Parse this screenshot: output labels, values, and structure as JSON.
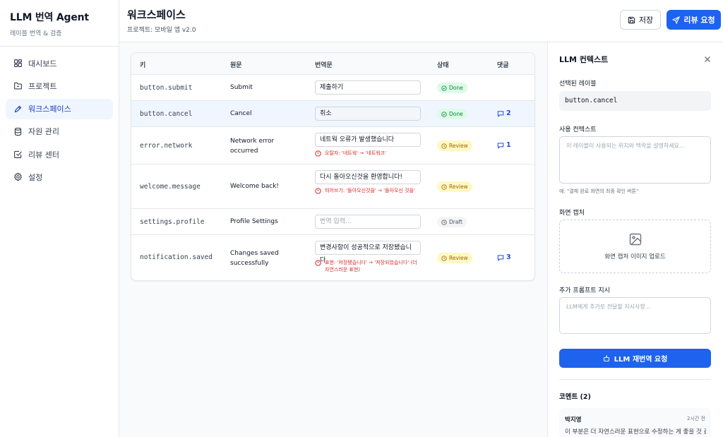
{
  "app": {
    "title": "LLM 번역 Agent",
    "subtitle": "레이블 번역 & 검증"
  },
  "sidebar": {
    "items": [
      {
        "label": "대시보드",
        "icon": "dashboard-icon"
      },
      {
        "label": "프로젝트",
        "icon": "folder-icon"
      },
      {
        "label": "워크스페이스",
        "icon": "pen-icon",
        "active": true
      },
      {
        "label": "자원 관리",
        "icon": "database-icon"
      },
      {
        "label": "리뷰 센터",
        "icon": "check-square-icon"
      },
      {
        "label": "설정",
        "icon": "gear-icon"
      }
    ]
  },
  "header": {
    "title": "워크스페이스",
    "subtitle": "프로젝트: 모바일 앱 v2.0",
    "save_label": "저장",
    "review_label": "리뷰 요청"
  },
  "table": {
    "headers": {
      "key": "키",
      "source": "원문",
      "translation": "번역문",
      "status": "상태",
      "comments": "댓글"
    },
    "rows": [
      {
        "key": "button.submit",
        "source": "Submit",
        "translation": "제출하기",
        "status": "Done",
        "comments": ""
      },
      {
        "key": "button.cancel",
        "source": "Cancel",
        "translation": "취소",
        "status": "Done",
        "comments": "2",
        "selected": true
      },
      {
        "key": "error.network",
        "source": "Network error occurred",
        "translation": "네트웍 오류가 발생했습니다",
        "warning": "오탈자: '네트웍' → '네트워크'",
        "status": "Review",
        "comments": "1"
      },
      {
        "key": "welcome.message",
        "source": "Welcome back!",
        "translation": "다시 돌아오신것을 환영합니다!",
        "warning": "띄어쓰기: '돌아오신것을' → '돌아오신 것을'",
        "status": "Review",
        "comments": ""
      },
      {
        "key": "settings.profile",
        "source": "Profile Settings",
        "translation": "",
        "placeholder": "번역 입력...",
        "status": "Draft",
        "comments": ""
      },
      {
        "key": "notification.saved",
        "source": "Changes saved successfully",
        "translation": "변경사항이 성공적으로 저장됐습니다",
        "warning": "표현: '저장됐습니다' → '저장되었습니다' (더 자연스러운 표현)",
        "status": "Review",
        "comments": "3"
      }
    ]
  },
  "panel": {
    "title": "LLM 컨텍스트",
    "selected_label_title": "선택된 레이블",
    "selected_label_value": "button.cancel",
    "context_title": "사용 컨텍스트",
    "context_placeholder": "이 레이블이 사용되는 위치와 맥락을 설명하세요...",
    "context_hint": "예: \"결제 완료 화면의 최종 확인 버튼\"",
    "capture_title": "화면 캡처",
    "capture_upload": "화면 캡처 이미지 업로드",
    "prompt_title": "추가 프롬프트 지시",
    "prompt_placeholder": "LLM에게 추가로 전달할 지시사항...",
    "retranslate_label": "LLM 재번역 요청",
    "comments_title": "코멘트 (2)",
    "comment": {
      "author": "박지영",
      "time": "2시간 전",
      "text": "이 부분은 더 자연스러운 표현으로 수정하는 게 좋을 것 같아요"
    }
  },
  "colors": {
    "accent": "#1d63ed",
    "done": "#15803d",
    "review": "#a16207",
    "draft": "#4b5563",
    "error": "#dc2626"
  }
}
